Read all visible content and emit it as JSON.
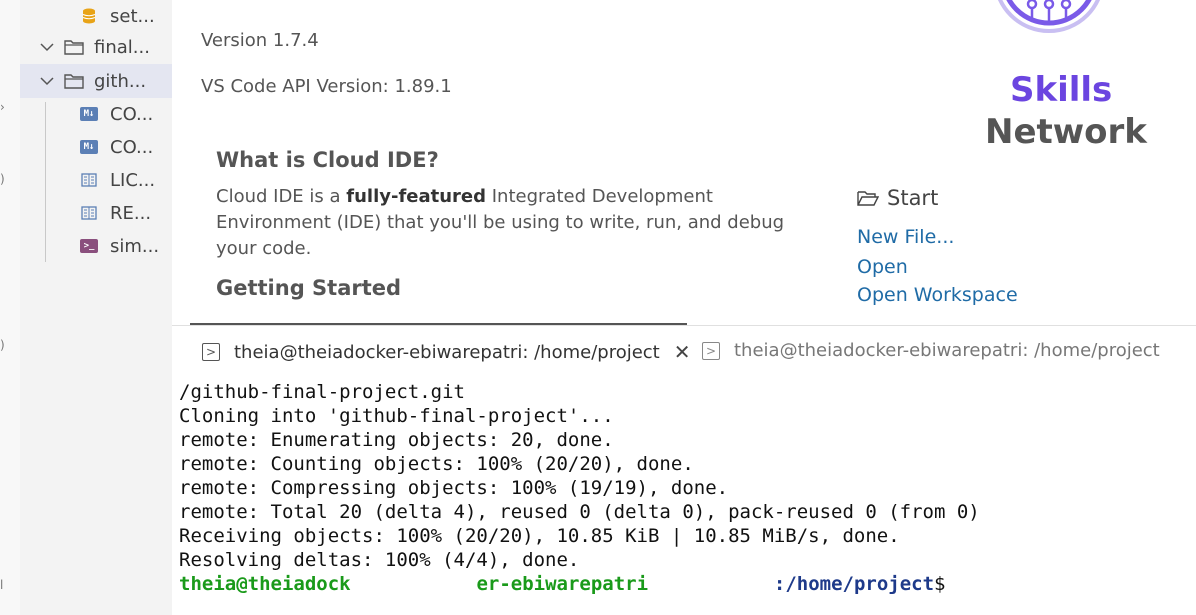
{
  "explorer": {
    "items": [
      {
        "label": "set...",
        "type": "file",
        "icon": "database-icon"
      },
      {
        "label": "final...",
        "type": "folder",
        "icon": "folder-icon"
      },
      {
        "label": "gith...",
        "type": "folder",
        "icon": "folder-icon"
      },
      {
        "label": "CO...",
        "type": "file",
        "icon": "markdown-icon"
      },
      {
        "label": "CO...",
        "type": "file",
        "icon": "markdown-icon"
      },
      {
        "label": "LIC...",
        "type": "file",
        "icon": "license-icon"
      },
      {
        "label": "RE...",
        "type": "file",
        "icon": "readme-icon"
      },
      {
        "label": "sim...",
        "type": "file",
        "icon": "shell-icon"
      }
    ]
  },
  "welcome": {
    "version": "Version 1.7.4",
    "api_version": "VS Code API Version: 1.89.1",
    "cloud_ide_title": "What is Cloud IDE?",
    "cloud_ide_text_1": "Cloud IDE is a ",
    "cloud_ide_bold": "fully-featured",
    "cloud_ide_text_2": " Integrated Development Environment (IDE) that you'll be using to write, run, and debug your code.",
    "getting_started_title": "Getting Started",
    "start_title": "Start",
    "links": {
      "new_file": "New File...",
      "open": "Open",
      "open_workspace": "Open Workspace"
    },
    "logo": {
      "line1": "Skills",
      "line2": "Network"
    }
  },
  "terminal": {
    "tabs": [
      {
        "label": "theia@theiadocker-ebiwarepatri: /home/project"
      },
      {
        "label": "theia@theiadocker-ebiwarepatri: /home/project"
      }
    ],
    "lines": [
      "/github-final-project.git",
      "Cloning into 'github-final-project'...",
      "remote: Enumerating objects: 20, done.",
      "remote: Counting objects: 100% (20/20), done.",
      "remote: Compressing objects: 100% (19/19), done.",
      "remote: Total 20 (delta 4), reused 0 (delta 0), pack-reused 0 (from 0)",
      "Receiving objects: 100% (20/20), 10.85 KiB | 10.85 MiB/s, done.",
      "Resolving deltas: 100% (4/4), done."
    ],
    "prompt_user_a": "theia@theiadock",
    "prompt_user_b": "er-ebiwarepatri",
    "prompt_path": ":/home/project",
    "prompt_symbol": "$"
  }
}
